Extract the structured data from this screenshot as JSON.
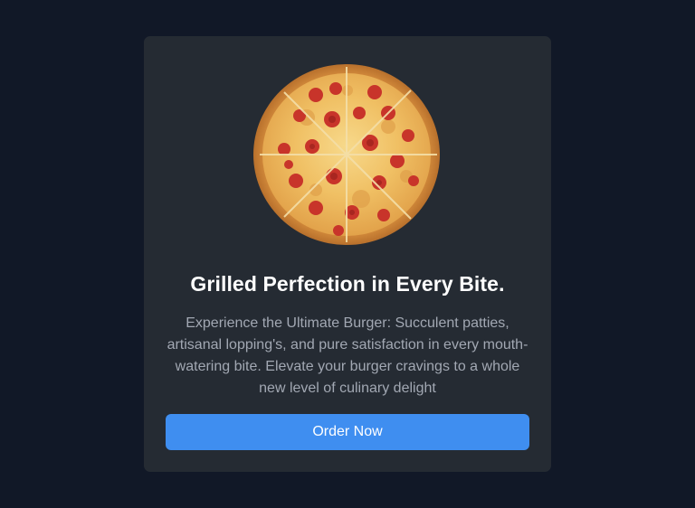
{
  "card": {
    "image": "pizza-image",
    "title": "Grilled Perfection in Every Bite.",
    "description": "Experience the Ultimate Burger: Succulent patties, artisanal lopping's, and pure satisfaction in every mouth-watering bite. Elevate your burger cravings to a whole new level of culinary delight",
    "button_label": "Order Now"
  },
  "colors": {
    "page_background": "#111827",
    "card_background": "#252b33",
    "button_background": "#3f8ef0",
    "title_text": "#ffffff",
    "description_text": "#a2a8b3"
  }
}
